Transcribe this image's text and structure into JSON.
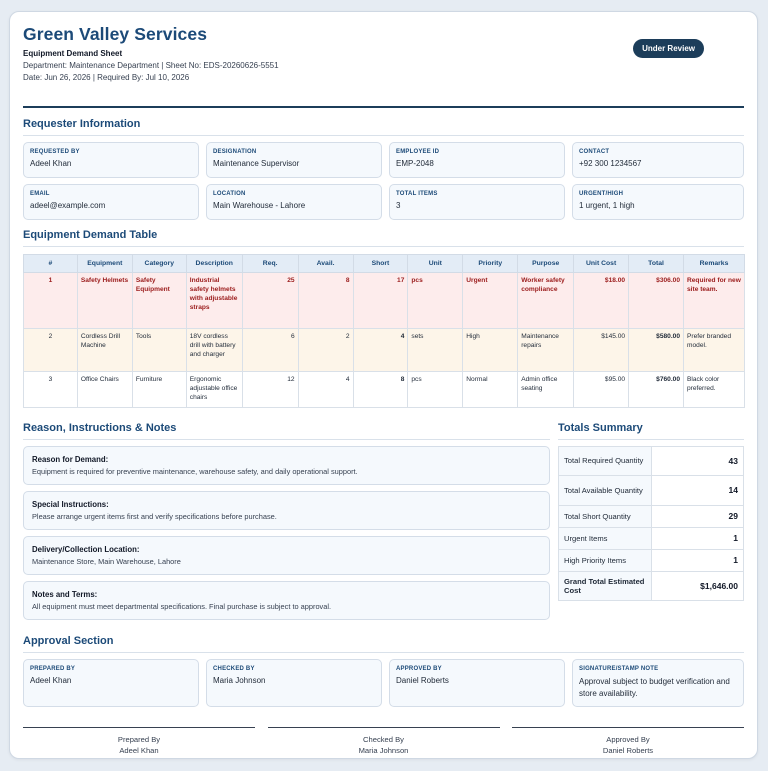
{
  "header": {
    "company": "Green Valley Services",
    "sheet_title": "Equipment Demand Sheet",
    "dept_line": "Department: Maintenance Department | Sheet No: EDS-20260626-5551",
    "date_line": "Date: Jun 26, 2026 | Required By: Jul 10, 2026",
    "status": "Under Review"
  },
  "requester": {
    "title": "Requester Information",
    "fields": [
      {
        "label": "Requested By",
        "value": "Adeel Khan"
      },
      {
        "label": "Designation",
        "value": "Maintenance Supervisor"
      },
      {
        "label": "Employee ID",
        "value": "EMP-2048"
      },
      {
        "label": "Contact",
        "value": "+92 300 1234567"
      },
      {
        "label": "Email",
        "value": "adeel@example.com"
      },
      {
        "label": "Location",
        "value": "Main Warehouse - Lahore"
      },
      {
        "label": "Total Items",
        "value": "3"
      },
      {
        "label": "Urgent/High",
        "value": "1 urgent, 1 high"
      }
    ]
  },
  "demand_table": {
    "title": "Equipment Demand Table",
    "columns": [
      "#",
      "Equipment",
      "Category",
      "Description",
      "Req.",
      "Avail.",
      "Short",
      "Unit",
      "Priority",
      "Purpose",
      "Unit Cost",
      "Total",
      "Remarks"
    ],
    "rows": [
      {
        "no": "1",
        "equipment": "Safety Helmets",
        "category": "Safety Equipment",
        "description": "Industrial safety helmets with adjustable straps",
        "req": "25",
        "avail": "8",
        "short": "17",
        "unit": "pcs",
        "priority": "Urgent",
        "purpose": "Worker safety compliance",
        "unit_cost": "$18.00",
        "total": "$306.00",
        "remarks": "Required for new site team."
      },
      {
        "no": "2",
        "equipment": "Cordless Drill Machine",
        "category": "Tools",
        "description": "18V cordless drill with battery and charger",
        "req": "6",
        "avail": "2",
        "short": "4",
        "unit": "sets",
        "priority": "High",
        "purpose": "Maintenance repairs",
        "unit_cost": "$145.00",
        "total": "$580.00",
        "remarks": "Prefer branded model."
      },
      {
        "no": "3",
        "equipment": "Office Chairs",
        "category": "Furniture",
        "description": "Ergonomic adjustable office chairs",
        "req": "12",
        "avail": "4",
        "short": "8",
        "unit": "pcs",
        "priority": "Normal",
        "purpose": "Admin office seating",
        "unit_cost": "$95.00",
        "total": "$760.00",
        "remarks": "Black color preferred."
      }
    ]
  },
  "notes": {
    "title": "Reason, Instructions & Notes",
    "items": [
      {
        "title": "Reason for Demand:",
        "body": "Equipment is required for preventive maintenance, warehouse safety, and daily operational support."
      },
      {
        "title": "Special Instructions:",
        "body": "Please arrange urgent items first and verify specifications before purchase."
      },
      {
        "title": "Delivery/Collection Location:",
        "body": "Maintenance Store, Main Warehouse, Lahore"
      },
      {
        "title": "Notes and Terms:",
        "body": "All equipment must meet departmental specifications. Final purchase is subject to approval."
      }
    ]
  },
  "totals": {
    "title": "Totals Summary",
    "rows": [
      {
        "label": "Total Required Quantity",
        "value": "43"
      },
      {
        "label": "Total Available Quantity",
        "value": "14"
      },
      {
        "label": "Total Short Quantity",
        "value": "29"
      },
      {
        "label": "Urgent Items",
        "value": "1"
      },
      {
        "label": "High Priority Items",
        "value": "1"
      },
      {
        "label": "Grand Total Estimated Cost",
        "value": "$1,646.00"
      }
    ]
  },
  "approval": {
    "title": "Approval Section",
    "cards": [
      {
        "label": "Prepared By",
        "value": "Adeel Khan"
      },
      {
        "label": "Checked By",
        "value": "Maria Johnson"
      },
      {
        "label": "Approved By",
        "value": "Daniel Roberts"
      },
      {
        "label": "Signature/Stamp Note",
        "value": "Approval subject to budget verification and store availability."
      }
    ],
    "signatures": [
      {
        "role": "Prepared By",
        "name": "Adeel Khan"
      },
      {
        "role": "Checked By",
        "name": "Maria Johnson"
      },
      {
        "role": "Approved By",
        "name": "Daniel Roberts"
      }
    ]
  }
}
